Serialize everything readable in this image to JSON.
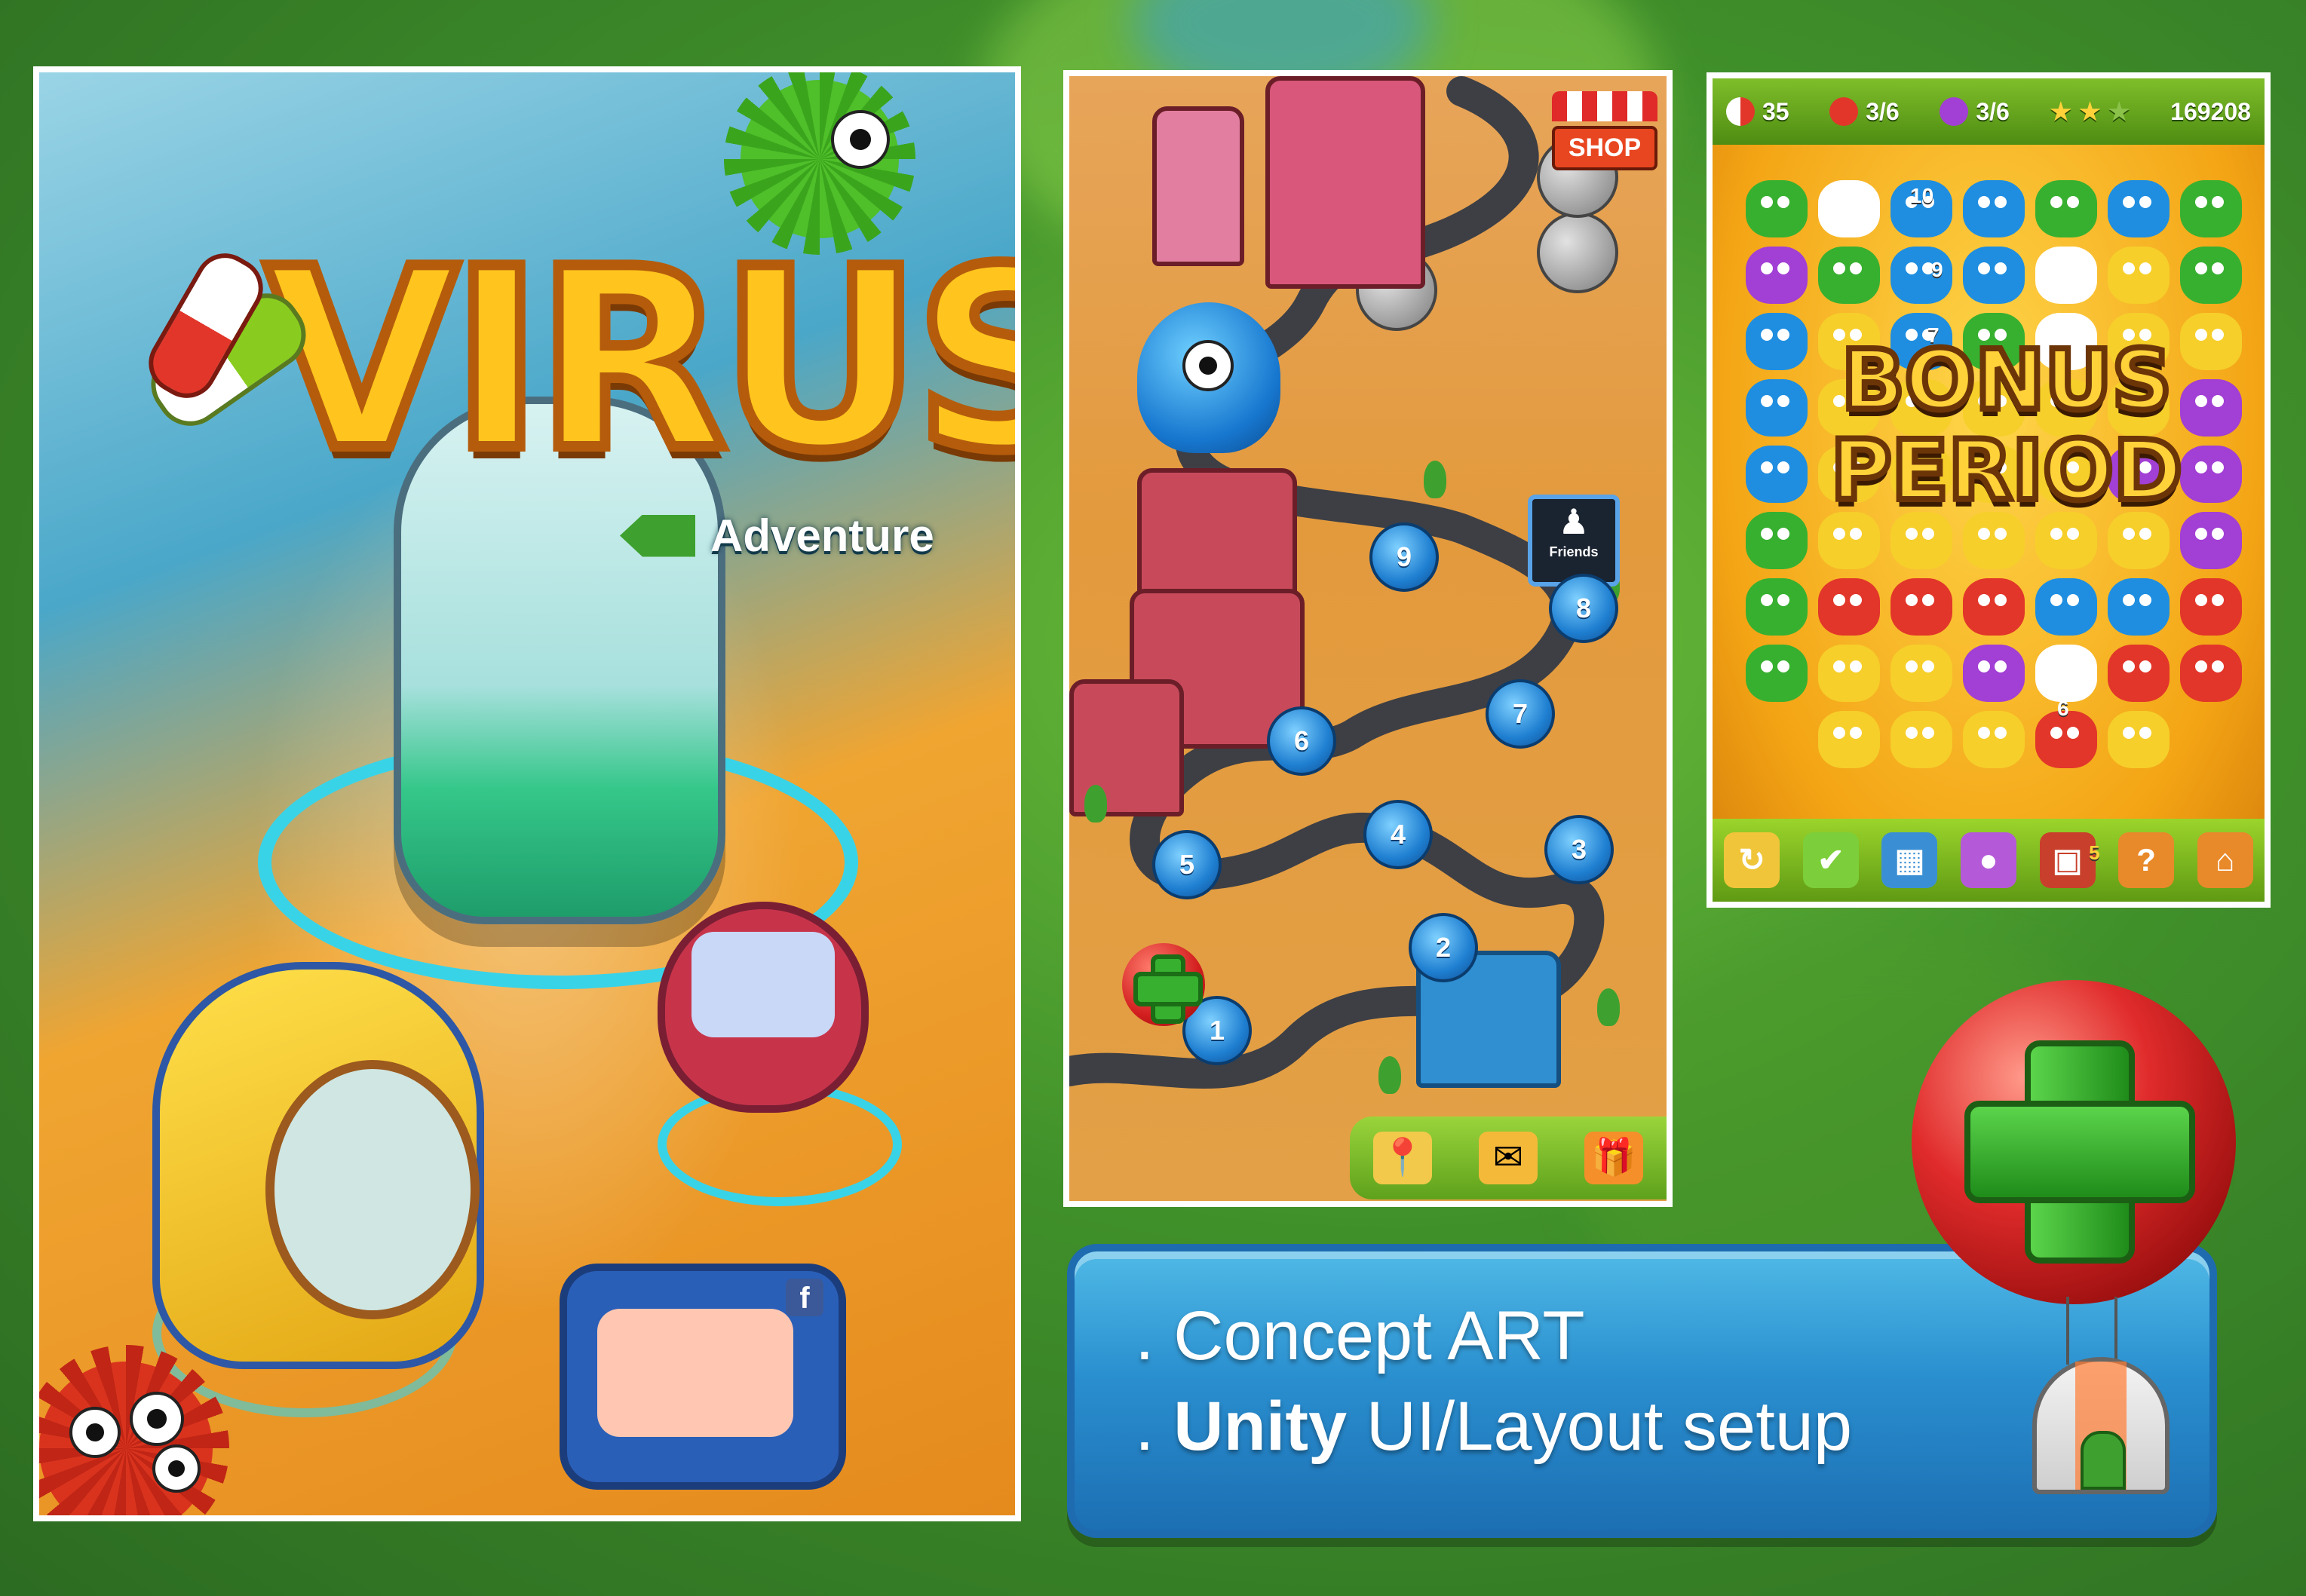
{
  "title_screen": {
    "logo_text": "VIRUS",
    "adventure_label": "Adventure",
    "facebook_badge": "f"
  },
  "map_screen": {
    "shop_label": "SHOP",
    "friends_label": "Friends",
    "levels": [
      "1",
      "2",
      "3",
      "4",
      "5",
      "6",
      "7",
      "8",
      "9"
    ],
    "bottom_icons": [
      "map-pin-icon",
      "mail-icon",
      "gift-icon"
    ]
  },
  "board_screen": {
    "hud": {
      "pills": "35",
      "virus_red": "3/6",
      "virus_purple": "3/6",
      "score": "169208"
    },
    "bonus_line1": "BONUS",
    "bonus_line2": "PERIOD",
    "counts": [
      "10",
      "9",
      "7",
      "6"
    ],
    "bottom_badge": "5",
    "help_label": "?"
  },
  "info": {
    "line1": ". Concept ART",
    "line2_bold": "Unity",
    "line2_rest": " UI/Layout setup"
  },
  "colors": {
    "virus_green": "#37b030",
    "virus_blue": "#1f8ee0",
    "virus_yellow": "#f6cf2a",
    "virus_red": "#e2362a",
    "virus_purple": "#a23fd4"
  }
}
